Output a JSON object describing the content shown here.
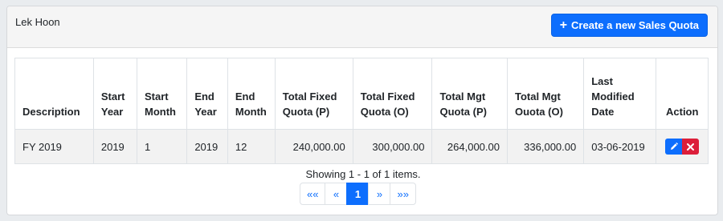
{
  "header": {
    "user_name": "Lek Hoon",
    "create_button_label": "Create a new Sales Quota",
    "create_button_icon": "plus-icon"
  },
  "table": {
    "columns": [
      "Description",
      "Start Year",
      "Start Month",
      "End Year",
      "End Month",
      "Total Fixed Quota (P)",
      "Total Fixed Quota (O)",
      "Total Mgt Quota (P)",
      "Total Mgt Ouota (O)",
      "Last Modified Date",
      "Action"
    ],
    "rows": [
      {
        "description": "FY 2019",
        "start_year": "2019",
        "start_month": "1",
        "end_year": "2019",
        "end_month": "12",
        "fixed_p": "240,000.00",
        "fixed_o": "300,000.00",
        "mgt_p": "264,000.00",
        "mgt_o": "336,000.00",
        "last_modified": "03-06-2019",
        "edit_icon": "pencil-icon",
        "delete_icon": "close-icon"
      }
    ]
  },
  "pagination": {
    "summary": "Showing 1 - 1 of 1 items.",
    "first": "««",
    "prev": "«",
    "current": "1",
    "next": "»",
    "last": "»»"
  },
  "colors": {
    "primary": "#0d6efd",
    "danger": "#dc1f3a"
  }
}
